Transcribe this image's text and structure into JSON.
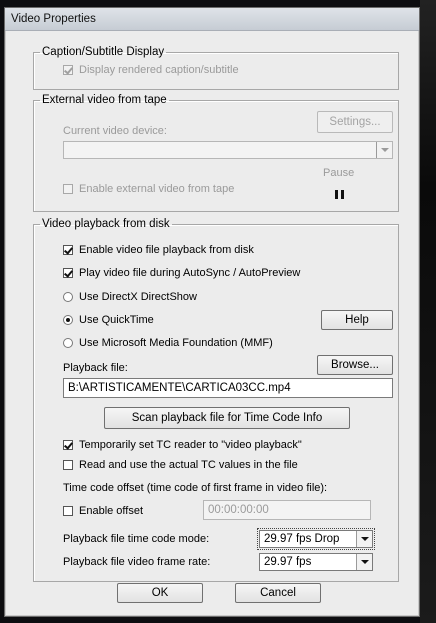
{
  "window": {
    "title": "Video Properties"
  },
  "caption_group": {
    "legend": "Caption/Subtitle Display",
    "display_rendered_label": "Display rendered caption/subtitle",
    "display_rendered_checked": true
  },
  "tape_group": {
    "legend": "External video from tape",
    "settings_label": "Settings...",
    "current_device_label": "Current video device:",
    "current_device_value": "",
    "enable_external_label": "Enable external video from tape",
    "enable_external_checked": false,
    "pause_label": "Pause",
    "pause_icon": "pause-icon"
  },
  "disk_group": {
    "legend": "Video playback from disk",
    "enable_playback_label": "Enable video file playback from disk",
    "enable_playback_checked": true,
    "play_during_autosync_label": "Play video file during AutoSync / AutoPreview",
    "play_during_autosync_checked": true,
    "radio_options": [
      {
        "label": "Use DirectX DirectShow",
        "selected": false
      },
      {
        "label": "Use QuickTime",
        "selected": true
      },
      {
        "label": "Use Microsoft Media Foundation (MMF)",
        "selected": false
      }
    ],
    "help_label": "Help",
    "playback_file_label": "Playback file:",
    "browse_label": "Browse...",
    "playback_file_value": "B:\\ARTISTICAMENTE\\CARTICA03CC.mp4",
    "scan_label": "Scan playback file for Time Code Info",
    "temp_tc_reader_label": "Temporarily set TC reader to \"video playback\"",
    "temp_tc_reader_checked": true,
    "read_actual_tc_label": "Read and use the actual TC values in the file",
    "read_actual_tc_checked": false,
    "tc_offset_label": "Time code offset (time code of first frame in video file):",
    "enable_offset_label": "Enable offset",
    "enable_offset_checked": false,
    "offset_value": "00:00:00:00",
    "tc_mode_label": "Playback file time code mode:",
    "tc_mode_value": "29.97 fps Drop",
    "frame_rate_label": "Playback file video frame rate:",
    "frame_rate_value": "29.97 fps"
  },
  "footer": {
    "ok_label": "OK",
    "cancel_label": "Cancel"
  }
}
